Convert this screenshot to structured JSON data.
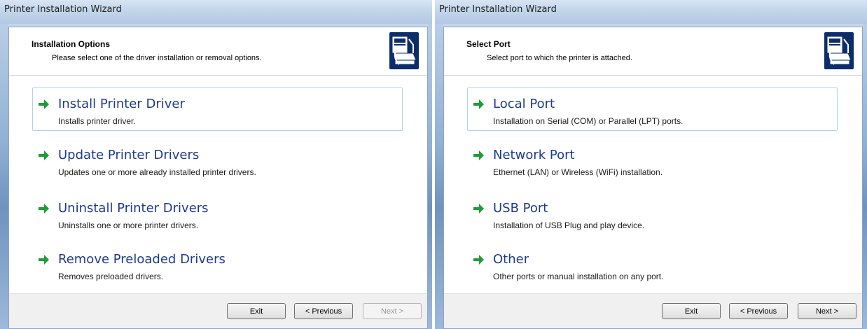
{
  "left_window": {
    "title": "Printer Installation Wizard",
    "header_title": "Installation Options",
    "header_subtitle": "Please select one of the driver installation or removal options.",
    "options": [
      {
        "label": "Install Printer Driver",
        "description": "Installs printer driver.",
        "selected": true
      },
      {
        "label": "Update Printer Drivers",
        "description": "Updates one or more already installed printer drivers.",
        "selected": false
      },
      {
        "label": "Uninstall Printer Drivers",
        "description": "Uninstalls one or more printer drivers.",
        "selected": false
      },
      {
        "label": "Remove Preloaded Drivers",
        "description": "Removes preloaded drivers.",
        "selected": false
      }
    ],
    "buttons": {
      "exit": "Exit",
      "previous": "< Previous",
      "next": "Next >",
      "next_enabled": false
    }
  },
  "right_window": {
    "title": "Printer Installation Wizard",
    "header_title": "Select Port",
    "header_subtitle": "Select port to which the printer is attached.",
    "options": [
      {
        "label": "Local Port",
        "description": "Installation on Serial (COM) or Parallel (LPT) ports.",
        "selected": true
      },
      {
        "label": "Network Port",
        "description": "Ethernet (LAN) or Wireless (WiFi) installation.",
        "selected": false
      },
      {
        "label": "USB Port",
        "description": "Installation of USB Plug and play device.",
        "selected": false
      },
      {
        "label": "Other",
        "description": "Other ports or manual installation on any port.",
        "selected": false
      }
    ],
    "buttons": {
      "exit": "Exit",
      "previous": "< Previous",
      "next": "Next >",
      "next_enabled": true
    }
  },
  "icons": {
    "option_arrow": "green-right-arrow-icon",
    "header_logo": "printer-wizard-icon"
  },
  "colors": {
    "option_label": "#1e3a8f",
    "arrow": "#1f9b3a",
    "selection_border": "#a9d3f0",
    "header_icon_bg": "#0d2d6a"
  }
}
